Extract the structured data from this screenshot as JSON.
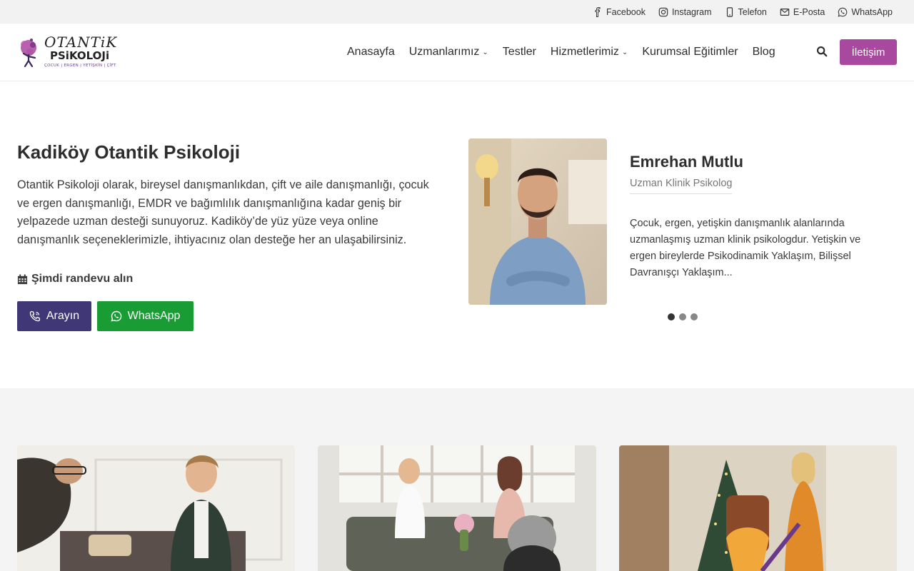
{
  "topbar": {
    "links": [
      {
        "label": "Facebook",
        "icon": "facebook-icon"
      },
      {
        "label": "Instagram",
        "icon": "instagram-icon"
      },
      {
        "label": "Telefon",
        "icon": "phone-icon"
      },
      {
        "label": "E-Posta",
        "icon": "mail-icon"
      },
      {
        "label": "WhatsApp",
        "icon": "whatsapp-icon"
      }
    ]
  },
  "header": {
    "logo": {
      "line1": "OTANTiK",
      "line2": "PSiKOLOJi",
      "tagline": "ÇOCUK | ERGEN | YETİŞKİN | ÇİFT"
    },
    "nav": [
      {
        "label": "Anasayfa",
        "has_dropdown": false
      },
      {
        "label": "Uzmanlarımız",
        "has_dropdown": true
      },
      {
        "label": "Testler",
        "has_dropdown": false
      },
      {
        "label": "Hizmetlerimiz",
        "has_dropdown": true
      },
      {
        "label": "Kurumsal Eğitimler",
        "has_dropdown": false
      },
      {
        "label": "Blog",
        "has_dropdown": false
      }
    ],
    "contact_label": "İletişim",
    "accent_color": "#a8489f"
  },
  "hero": {
    "title": "Kadiköy Otantik Psikoloji",
    "description": "Otantik Psikoloji olarak, bireysel danışmanlıkdan, çift ve aile danışmanlığı, çocuk ve ergen danışmanlığı, EMDR ve bağımlılık danışmanlığına kadar geniş bir yelpazede uzman desteği sunuyoruz. Kadiköy’de yüz yüze veya online danışmanlık seçeneklerimizle, ihtiyacınız olan desteğe her an ulaşabilirsiniz.",
    "appointment_label": "Şimdi randevu alın",
    "call_label": "Arayın",
    "whatsapp_label": "WhatsApp",
    "call_color": "#3f3776",
    "whatsapp_color": "#1a9c35"
  },
  "expert": {
    "name": "Emrehan Mutlu",
    "role": "Uzman Klinik Psikolog",
    "bio": "Çocuk, ergen, yetişkin danışmanlık alanlarında uzmanlaşmış uzman klinik psikologdur. Yetişkin ve ergen bireylerde Psikodinamik Yaklaşım, Bilişsel Davranışçı Yaklaşım...",
    "slides_total": 3,
    "active_slide": 1
  }
}
